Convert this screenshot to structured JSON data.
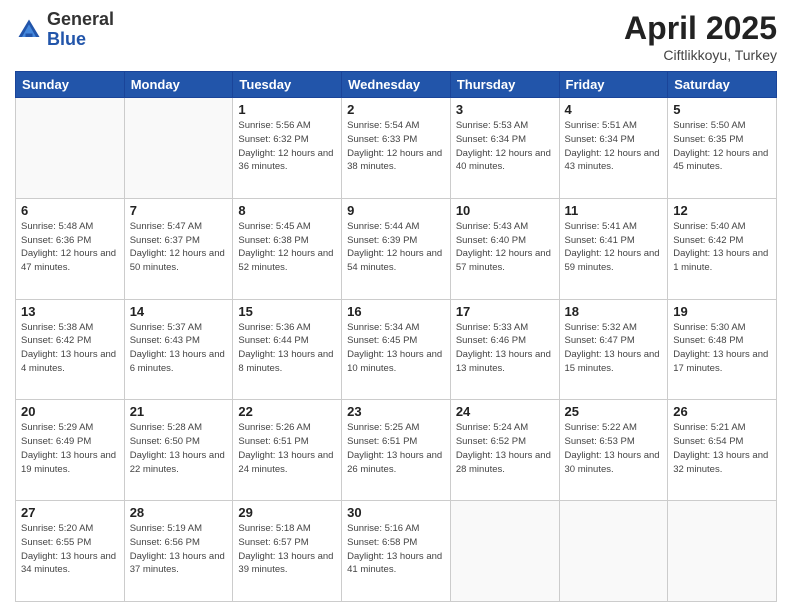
{
  "logo": {
    "general": "General",
    "blue": "Blue"
  },
  "title": {
    "main": "April 2025",
    "sub": "Ciftlikkoyu, Turkey"
  },
  "weekdays": [
    "Sunday",
    "Monday",
    "Tuesday",
    "Wednesday",
    "Thursday",
    "Friday",
    "Saturday"
  ],
  "weeks": [
    [
      {
        "day": "",
        "info": ""
      },
      {
        "day": "",
        "info": ""
      },
      {
        "day": "1",
        "info": "Sunrise: 5:56 AM\nSunset: 6:32 PM\nDaylight: 12 hours and 36 minutes."
      },
      {
        "day": "2",
        "info": "Sunrise: 5:54 AM\nSunset: 6:33 PM\nDaylight: 12 hours and 38 minutes."
      },
      {
        "day": "3",
        "info": "Sunrise: 5:53 AM\nSunset: 6:34 PM\nDaylight: 12 hours and 40 minutes."
      },
      {
        "day": "4",
        "info": "Sunrise: 5:51 AM\nSunset: 6:34 PM\nDaylight: 12 hours and 43 minutes."
      },
      {
        "day": "5",
        "info": "Sunrise: 5:50 AM\nSunset: 6:35 PM\nDaylight: 12 hours and 45 minutes."
      }
    ],
    [
      {
        "day": "6",
        "info": "Sunrise: 5:48 AM\nSunset: 6:36 PM\nDaylight: 12 hours and 47 minutes."
      },
      {
        "day": "7",
        "info": "Sunrise: 5:47 AM\nSunset: 6:37 PM\nDaylight: 12 hours and 50 minutes."
      },
      {
        "day": "8",
        "info": "Sunrise: 5:45 AM\nSunset: 6:38 PM\nDaylight: 12 hours and 52 minutes."
      },
      {
        "day": "9",
        "info": "Sunrise: 5:44 AM\nSunset: 6:39 PM\nDaylight: 12 hours and 54 minutes."
      },
      {
        "day": "10",
        "info": "Sunrise: 5:43 AM\nSunset: 6:40 PM\nDaylight: 12 hours and 57 minutes."
      },
      {
        "day": "11",
        "info": "Sunrise: 5:41 AM\nSunset: 6:41 PM\nDaylight: 12 hours and 59 minutes."
      },
      {
        "day": "12",
        "info": "Sunrise: 5:40 AM\nSunset: 6:42 PM\nDaylight: 13 hours and 1 minute."
      }
    ],
    [
      {
        "day": "13",
        "info": "Sunrise: 5:38 AM\nSunset: 6:42 PM\nDaylight: 13 hours and 4 minutes."
      },
      {
        "day": "14",
        "info": "Sunrise: 5:37 AM\nSunset: 6:43 PM\nDaylight: 13 hours and 6 minutes."
      },
      {
        "day": "15",
        "info": "Sunrise: 5:36 AM\nSunset: 6:44 PM\nDaylight: 13 hours and 8 minutes."
      },
      {
        "day": "16",
        "info": "Sunrise: 5:34 AM\nSunset: 6:45 PM\nDaylight: 13 hours and 10 minutes."
      },
      {
        "day": "17",
        "info": "Sunrise: 5:33 AM\nSunset: 6:46 PM\nDaylight: 13 hours and 13 minutes."
      },
      {
        "day": "18",
        "info": "Sunrise: 5:32 AM\nSunset: 6:47 PM\nDaylight: 13 hours and 15 minutes."
      },
      {
        "day": "19",
        "info": "Sunrise: 5:30 AM\nSunset: 6:48 PM\nDaylight: 13 hours and 17 minutes."
      }
    ],
    [
      {
        "day": "20",
        "info": "Sunrise: 5:29 AM\nSunset: 6:49 PM\nDaylight: 13 hours and 19 minutes."
      },
      {
        "day": "21",
        "info": "Sunrise: 5:28 AM\nSunset: 6:50 PM\nDaylight: 13 hours and 22 minutes."
      },
      {
        "day": "22",
        "info": "Sunrise: 5:26 AM\nSunset: 6:51 PM\nDaylight: 13 hours and 24 minutes."
      },
      {
        "day": "23",
        "info": "Sunrise: 5:25 AM\nSunset: 6:51 PM\nDaylight: 13 hours and 26 minutes."
      },
      {
        "day": "24",
        "info": "Sunrise: 5:24 AM\nSunset: 6:52 PM\nDaylight: 13 hours and 28 minutes."
      },
      {
        "day": "25",
        "info": "Sunrise: 5:22 AM\nSunset: 6:53 PM\nDaylight: 13 hours and 30 minutes."
      },
      {
        "day": "26",
        "info": "Sunrise: 5:21 AM\nSunset: 6:54 PM\nDaylight: 13 hours and 32 minutes."
      }
    ],
    [
      {
        "day": "27",
        "info": "Sunrise: 5:20 AM\nSunset: 6:55 PM\nDaylight: 13 hours and 34 minutes."
      },
      {
        "day": "28",
        "info": "Sunrise: 5:19 AM\nSunset: 6:56 PM\nDaylight: 13 hours and 37 minutes."
      },
      {
        "day": "29",
        "info": "Sunrise: 5:18 AM\nSunset: 6:57 PM\nDaylight: 13 hours and 39 minutes."
      },
      {
        "day": "30",
        "info": "Sunrise: 5:16 AM\nSunset: 6:58 PM\nDaylight: 13 hours and 41 minutes."
      },
      {
        "day": "",
        "info": ""
      },
      {
        "day": "",
        "info": ""
      },
      {
        "day": "",
        "info": ""
      }
    ]
  ]
}
